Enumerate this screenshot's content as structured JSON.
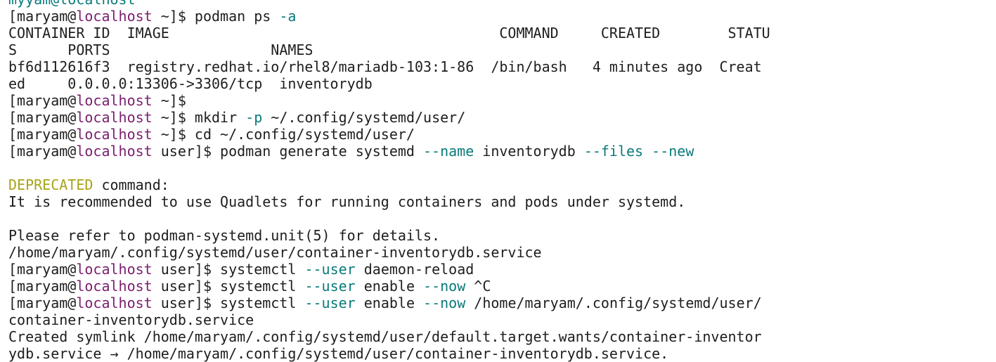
{
  "terminal": {
    "lines": [
      [
        {
          "t": "myyam@localhost",
          "c": "cut"
        }
      ],
      [
        {
          "t": "[maryam@",
          "c": "default"
        },
        {
          "t": "localhost",
          "c": "host"
        },
        {
          "t": " ~]$ podman ps ",
          "c": "default"
        },
        {
          "t": "-a",
          "c": "flag"
        }
      ],
      [
        {
          "t": "CONTAINER ID  IMAGE                                       COMMAND     CREATED        STATU",
          "c": "default"
        }
      ],
      [
        {
          "t": "S      PORTS                   NAMES",
          "c": "default"
        }
      ],
      [
        {
          "t": "bf6d112616f3  registry.redhat.io/rhel8/mariadb-103:1-86  /bin/bash   4 minutes ago  Creat",
          "c": "default"
        }
      ],
      [
        {
          "t": "ed     0.0.0.0:13306->3306/tcp  inventorydb",
          "c": "default"
        }
      ],
      [
        {
          "t": "[maryam@",
          "c": "default"
        },
        {
          "t": "localhost",
          "c": "host"
        },
        {
          "t": " ~]$",
          "c": "default"
        }
      ],
      [
        {
          "t": "[maryam@",
          "c": "default"
        },
        {
          "t": "localhost",
          "c": "host"
        },
        {
          "t": " ~]$ mkdir ",
          "c": "default"
        },
        {
          "t": "-p",
          "c": "flag"
        },
        {
          "t": " ~/.config/systemd/user/",
          "c": "default"
        }
      ],
      [
        {
          "t": "[maryam@",
          "c": "default"
        },
        {
          "t": "localhost",
          "c": "host"
        },
        {
          "t": " ~]$ cd ~/.config/systemd/user/",
          "c": "default"
        }
      ],
      [
        {
          "t": "[maryam@",
          "c": "default"
        },
        {
          "t": "localhost",
          "c": "host"
        },
        {
          "t": " user]$ podman generate systemd ",
          "c": "default"
        },
        {
          "t": "--name",
          "c": "flag"
        },
        {
          "t": " inventorydb ",
          "c": "default"
        },
        {
          "t": "--files",
          "c": "flag"
        },
        {
          "t": " ",
          "c": "default"
        },
        {
          "t": "--new",
          "c": "flag"
        }
      ],
      [
        {
          "t": "",
          "c": "default"
        }
      ],
      [
        {
          "t": "DEPRECATED",
          "c": "warn"
        },
        {
          "t": " command:",
          "c": "default"
        }
      ],
      [
        {
          "t": "It is recommended to use Quadlets for running containers and pods under systemd.",
          "c": "default"
        }
      ],
      [
        {
          "t": "",
          "c": "default"
        }
      ],
      [
        {
          "t": "Please refer to podman-systemd.unit(5) for details.",
          "c": "default"
        }
      ],
      [
        {
          "t": "/home/maryam/.config/systemd/user/container-inventorydb.service",
          "c": "default"
        }
      ],
      [
        {
          "t": "[maryam@",
          "c": "default"
        },
        {
          "t": "localhost",
          "c": "host"
        },
        {
          "t": " user]$ systemctl ",
          "c": "default"
        },
        {
          "t": "--user",
          "c": "flag"
        },
        {
          "t": " daemon-reload",
          "c": "default"
        }
      ],
      [
        {
          "t": "[maryam@",
          "c": "default"
        },
        {
          "t": "localhost",
          "c": "host"
        },
        {
          "t": " user]$ systemctl ",
          "c": "default"
        },
        {
          "t": "--user",
          "c": "flag"
        },
        {
          "t": " enable ",
          "c": "default"
        },
        {
          "t": "--now",
          "c": "flag"
        },
        {
          "t": " ^C",
          "c": "default"
        }
      ],
      [
        {
          "t": "[maryam@",
          "c": "default"
        },
        {
          "t": "localhost",
          "c": "host"
        },
        {
          "t": " user]$ systemctl ",
          "c": "default"
        },
        {
          "t": "--user",
          "c": "flag"
        },
        {
          "t": " enable ",
          "c": "default"
        },
        {
          "t": "--now",
          "c": "flag"
        },
        {
          "t": " /home/maryam/.config/systemd/user/",
          "c": "default"
        }
      ],
      [
        {
          "t": "container-inventorydb.service",
          "c": "default"
        }
      ],
      [
        {
          "t": "Created symlink /home/maryam/.config/systemd/user/default.target.wants/container-inventor",
          "c": "default"
        }
      ],
      [
        {
          "t": "ydb.service → /home/maryam/.config/systemd/user/container-inventorydb.service.",
          "c": "default"
        }
      ]
    ]
  }
}
